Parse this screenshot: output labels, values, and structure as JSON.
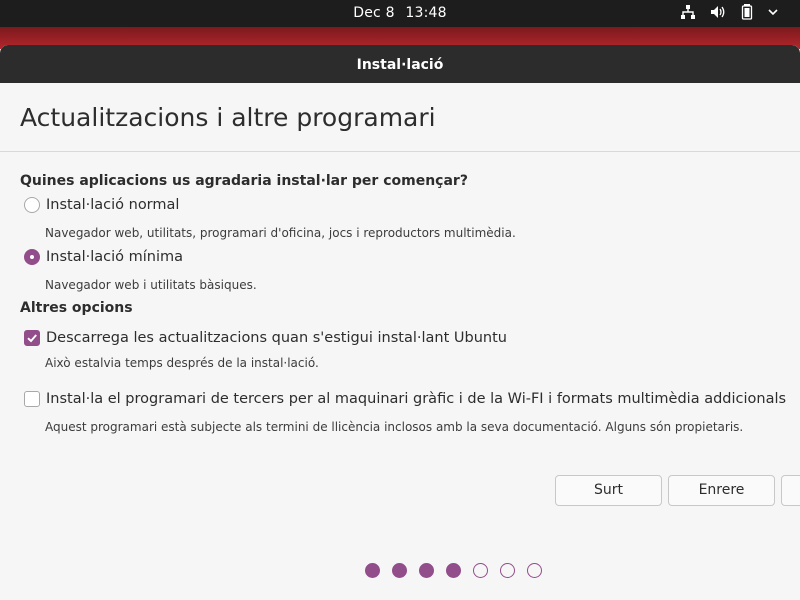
{
  "topbar": {
    "date": "Dec 8",
    "time": "13:48",
    "icons": [
      "network-icon",
      "volume-icon",
      "battery-icon",
      "system-menu-icon"
    ]
  },
  "window": {
    "title": "Instal·lació"
  },
  "page": {
    "title": "Actualitzacions i altre programari"
  },
  "apps_section": {
    "heading": "Quines aplicacions us agradaria instal·lar per començar?",
    "options": [
      {
        "label": "Instal·lació normal",
        "description": "Navegador web, utilitats, programari d'oficina, jocs i reproductors multimèdia.",
        "selected": false
      },
      {
        "label": "Instal·lació mínima",
        "description": "Navegador web i utilitats bàsiques.",
        "selected": true
      }
    ]
  },
  "other_section": {
    "heading": "Altres opcions",
    "options": [
      {
        "label": "Descarrega les actualitzacions quan s'estigui instal·lant Ubuntu",
        "description": "Això estalvia temps després de la instal·lació.",
        "checked": true
      },
      {
        "label": "Instal·la el programari de tercers per al maquinari gràfic i de la Wi-FI i formats multimèdia addicionals",
        "description": "Aquest programari està subjecte als termini de llicència inclosos amb la seva documentació. Alguns són propietaris.",
        "checked": false
      }
    ]
  },
  "buttons": {
    "quit": "Surt",
    "back": "Enrere",
    "continue": ""
  },
  "progress": {
    "total_steps": 7,
    "completed_steps": 4
  },
  "colors": {
    "accent": "#924d8b",
    "desktop_red": "#b3262c",
    "titlebar": "#2c2c2c"
  }
}
